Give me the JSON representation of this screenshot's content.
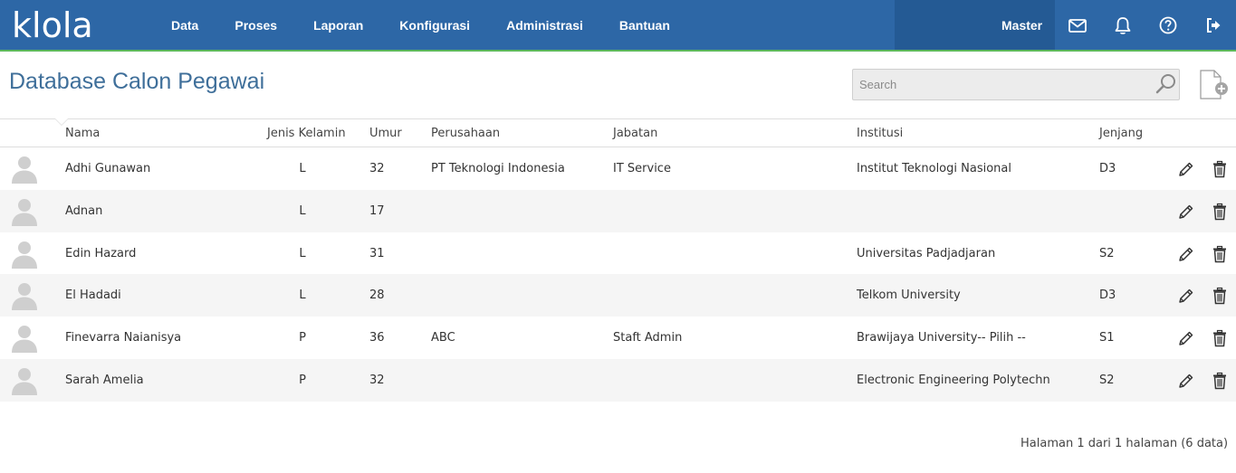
{
  "app": {
    "logo": "klola"
  },
  "nav": {
    "items": [
      "Data",
      "Proses",
      "Laporan",
      "Konfigurasi",
      "Administrasi",
      "Bantuan"
    ]
  },
  "topbar": {
    "master_label": "Master",
    "icons": [
      "mail-icon",
      "bell-icon",
      "help-icon",
      "logout-icon"
    ]
  },
  "page": {
    "title": "Database Calon Pegawai"
  },
  "search": {
    "placeholder": "Search",
    "value": ""
  },
  "table": {
    "columns": [
      "Nama",
      "Jenis Kelamin",
      "Umur",
      "Perusahaan",
      "Jabatan",
      "Institusi",
      "Jenjang"
    ],
    "rows": [
      {
        "nama": "Adhi Gunawan",
        "jk": "L",
        "umur": "32",
        "perusahaan": "PT Teknologi Indonesia",
        "jabatan": "IT Service",
        "institusi": "Institut Teknologi Nasional",
        "jenjang": "D3"
      },
      {
        "nama": "Adnan",
        "jk": "L",
        "umur": "17",
        "perusahaan": "",
        "jabatan": "",
        "institusi": "",
        "jenjang": ""
      },
      {
        "nama": "Edin Hazard",
        "jk": "L",
        "umur": "31",
        "perusahaan": "",
        "jabatan": "",
        "institusi": "Universitas Padjadjaran",
        "jenjang": "S2"
      },
      {
        "nama": "El Hadadi",
        "jk": "L",
        "umur": "28",
        "perusahaan": "",
        "jabatan": "",
        "institusi": "Telkom University",
        "jenjang": "D3"
      },
      {
        "nama": "Finevarra Naianisya",
        "jk": "P",
        "umur": "36",
        "perusahaan": "ABC",
        "jabatan": "Staft Admin",
        "institusi": "Brawijaya University-- Pilih --",
        "jenjang": "S1"
      },
      {
        "nama": "Sarah Amelia",
        "jk": "P",
        "umur": "32",
        "perusahaan": "",
        "jabatan": "",
        "institusi": "Electronic Engineering Polytechn",
        "jenjang": "S2"
      }
    ]
  },
  "pagination": {
    "text": "Halaman 1 dari 1 halaman (6 data)"
  },
  "colors": {
    "topbar": "#2d67a6",
    "topbar_dark": "#245a94",
    "accent_line": "#5cb85c",
    "title": "#3f6f9a"
  }
}
